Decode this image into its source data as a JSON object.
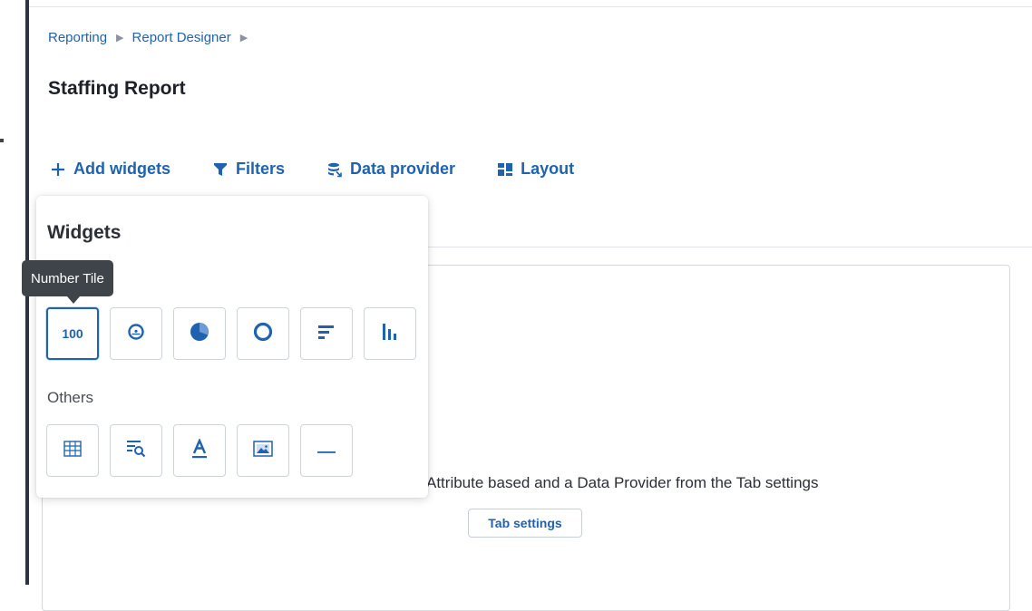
{
  "breadcrumb": {
    "items": [
      "Reporting",
      "Report Designer"
    ],
    "separator": "▶"
  },
  "page": {
    "title": "Staffing Report"
  },
  "toolbar": {
    "add_widgets": "Add widgets",
    "filters": "Filters",
    "data_provider": "Data provider",
    "layout": "Layout"
  },
  "widgets_panel": {
    "title": "Widgets",
    "others_label": "Others",
    "number_tile_value": "100",
    "tooltip": "Number Tile",
    "chart_tiles": [
      "number-tile",
      "gauge",
      "pie-chart",
      "donut-chart",
      "horizontal-bar-chart",
      "vertical-bar-chart"
    ],
    "other_tiles": [
      "table",
      "search-list",
      "text",
      "image",
      "divider-line"
    ]
  },
  "canvas": {
    "message": "Attribute based and a Data Provider from the Tab settings",
    "tab_settings_label": "Tab settings"
  },
  "colors": {
    "accent": "#1f63b0",
    "text": "#2b2f36",
    "tooltip_bg": "#3f444b",
    "border": "#cfd4db"
  }
}
